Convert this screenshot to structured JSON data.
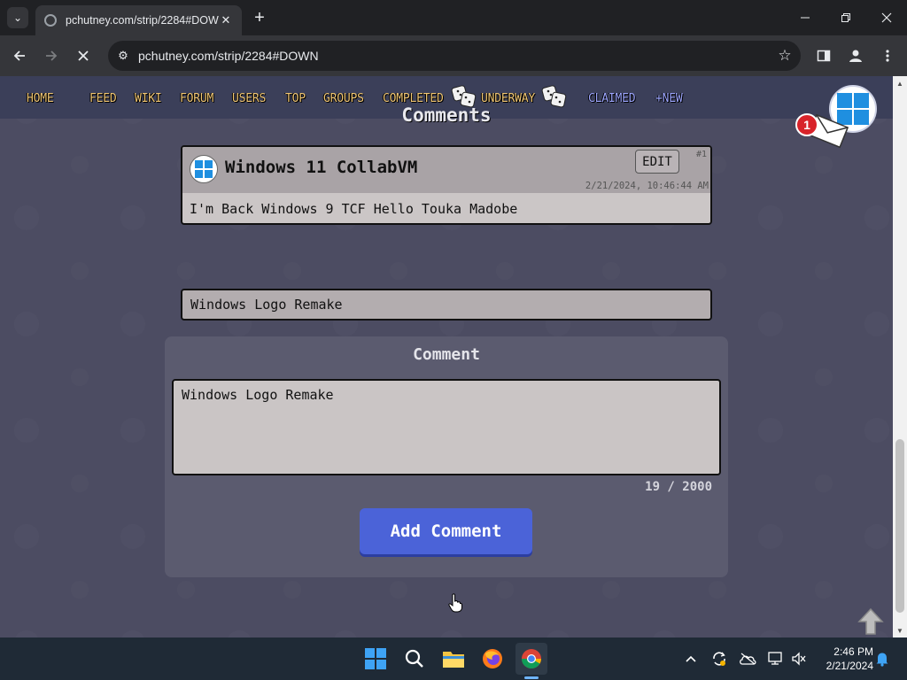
{
  "browser": {
    "tab_title": "pchutney.com/strip/2284#DOWN",
    "url": "pchutney.com/strip/2284#DOWN"
  },
  "site_nav": {
    "links": [
      "HOME",
      "FEED",
      "WIKI",
      "FORUM",
      "USERS",
      "TOP",
      "GROUPS",
      "COMPLETED",
      "UNDERWAY",
      "CLAIMED",
      "+NEW"
    ]
  },
  "notifications": {
    "count": "1"
  },
  "comments": {
    "heading": "Comments",
    "items": [
      {
        "author": "Windows 11 CollabVM",
        "edit_label": "EDIT",
        "number": "#1",
        "date": "2/21/2024, 10:46:44 AM",
        "text": "I'm Back Windows 9 TCF Hello Touka Madobe"
      }
    ]
  },
  "form": {
    "title_value": "Windows Logo Remake",
    "comment_label": "Comment",
    "comment_value": "Windows Logo Remake",
    "char_count": "19 / 2000",
    "submit_label": "Add Comment"
  },
  "taskbar": {
    "time": "2:46 PM",
    "date": "2/21/2024"
  },
  "colors": {
    "page_bg": "#4c4c62",
    "nav_gold": "#f0c674",
    "nav_blue": "#9da6ff",
    "button_blue": "#4b63d8"
  }
}
